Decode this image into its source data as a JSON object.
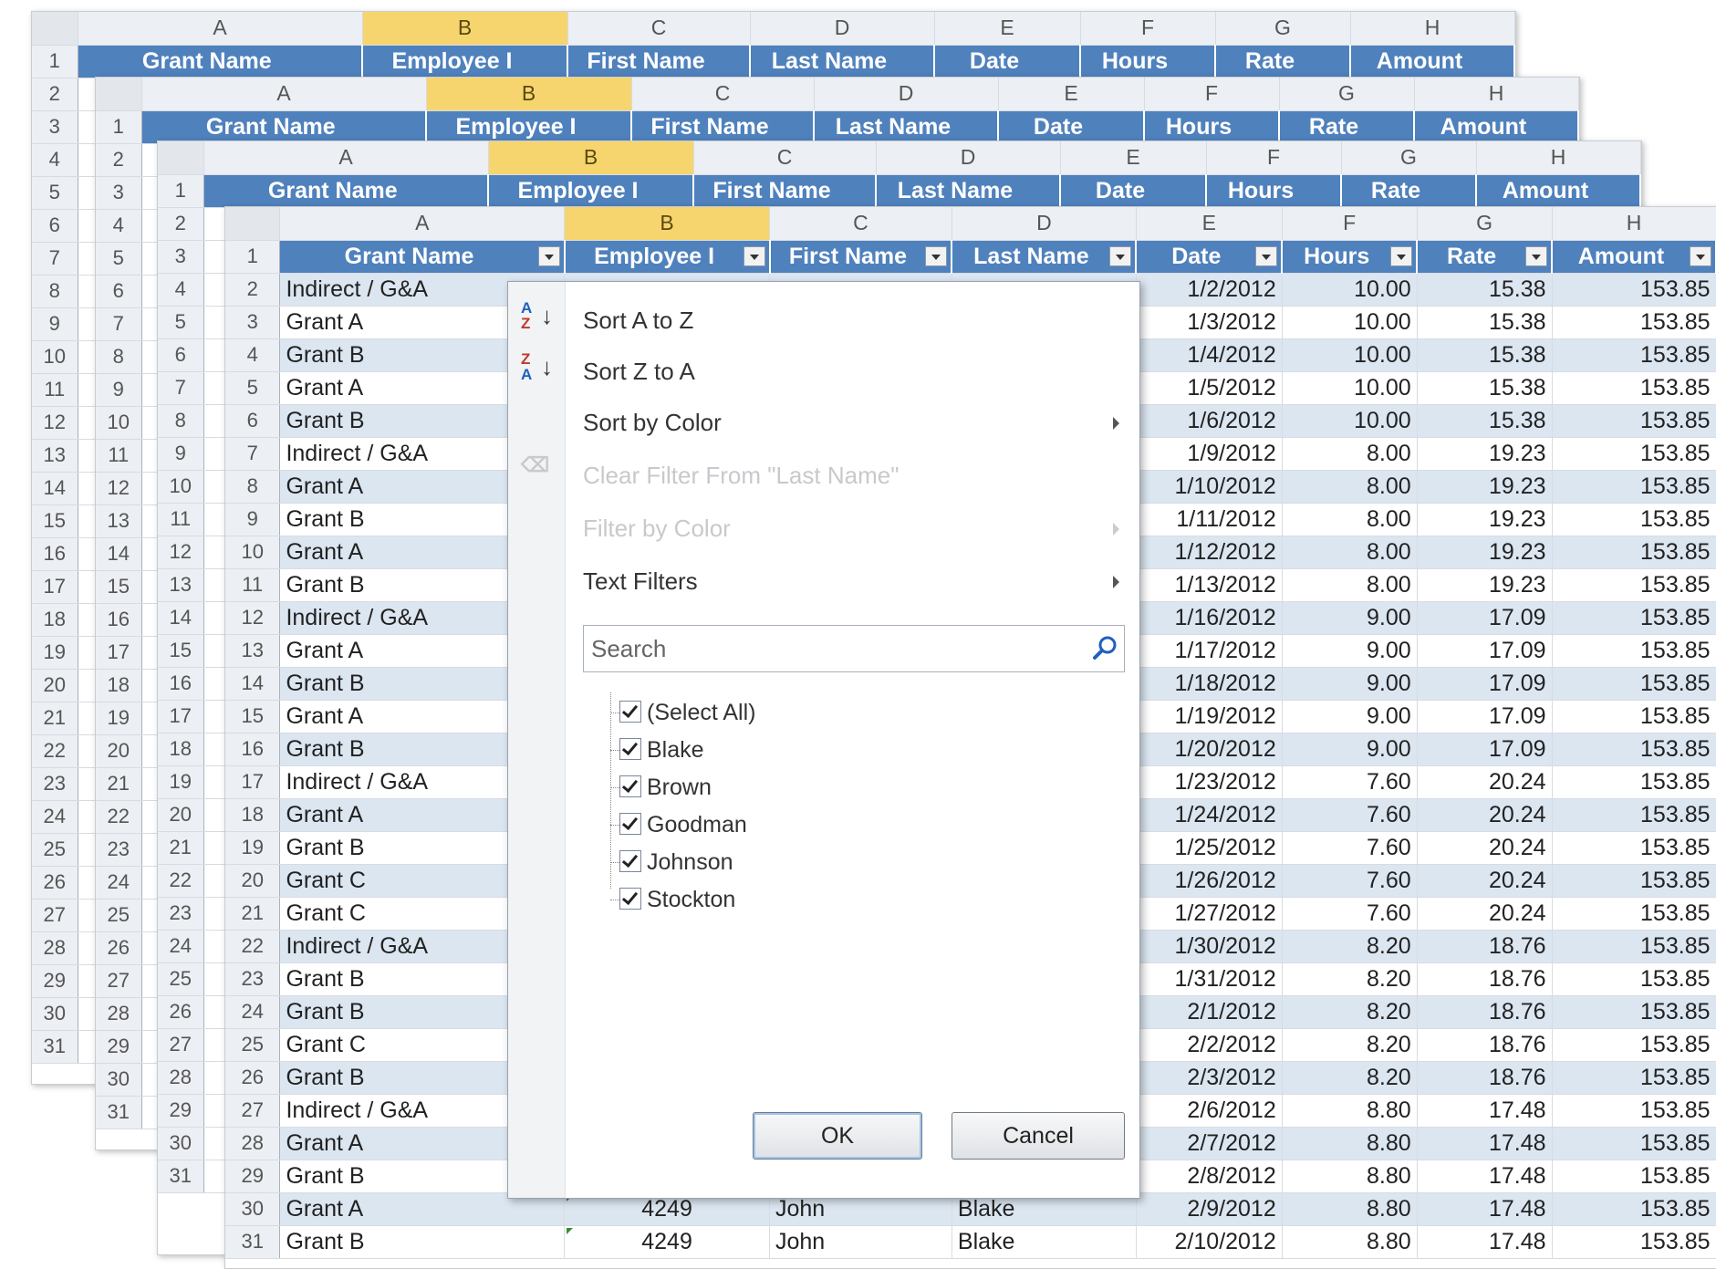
{
  "columns": [
    "A",
    "B",
    "C",
    "D",
    "E",
    "F",
    "G",
    "H"
  ],
  "selected_column": "B",
  "table_headers": [
    "Grant Name",
    "Employee I",
    "First Name",
    "Last Name",
    "Date",
    "Hours",
    "Rate",
    "Amount"
  ],
  "bg_rows_sheet1": [
    "1",
    "2",
    "3",
    "4",
    "5",
    "6",
    "7",
    "8",
    "9",
    "10",
    "11",
    "12",
    "13",
    "14",
    "15",
    "16",
    "17",
    "18",
    "19",
    "20",
    "21",
    "22",
    "23",
    "24",
    "25",
    "26",
    "27",
    "28",
    "29",
    "30",
    "31"
  ],
  "rows": [
    {
      "n": "2",
      "grant": "Indirect / G&A",
      "date": "1/2/2012",
      "hours": "10.00",
      "rate": "15.38",
      "amount": "153.85"
    },
    {
      "n": "3",
      "grant": "Grant A",
      "date": "1/3/2012",
      "hours": "10.00",
      "rate": "15.38",
      "amount": "153.85"
    },
    {
      "n": "4",
      "grant": "Grant B",
      "date": "1/4/2012",
      "hours": "10.00",
      "rate": "15.38",
      "amount": "153.85"
    },
    {
      "n": "5",
      "grant": "Grant A",
      "date": "1/5/2012",
      "hours": "10.00",
      "rate": "15.38",
      "amount": "153.85"
    },
    {
      "n": "6",
      "grant": "Grant B",
      "date": "1/6/2012",
      "hours": "10.00",
      "rate": "15.38",
      "amount": "153.85"
    },
    {
      "n": "7",
      "grant": "Indirect / G&A",
      "date": "1/9/2012",
      "hours": "8.00",
      "rate": "19.23",
      "amount": "153.85"
    },
    {
      "n": "8",
      "grant": "Grant A",
      "date": "1/10/2012",
      "hours": "8.00",
      "rate": "19.23",
      "amount": "153.85"
    },
    {
      "n": "9",
      "grant": "Grant B",
      "date": "1/11/2012",
      "hours": "8.00",
      "rate": "19.23",
      "amount": "153.85"
    },
    {
      "n": "10",
      "grant": "Grant A",
      "date": "1/12/2012",
      "hours": "8.00",
      "rate": "19.23",
      "amount": "153.85"
    },
    {
      "n": "11",
      "grant": "Grant B",
      "date": "1/13/2012",
      "hours": "8.00",
      "rate": "19.23",
      "amount": "153.85"
    },
    {
      "n": "12",
      "grant": "Indirect / G&A",
      "date": "1/16/2012",
      "hours": "9.00",
      "rate": "17.09",
      "amount": "153.85"
    },
    {
      "n": "13",
      "grant": "Grant A",
      "date": "1/17/2012",
      "hours": "9.00",
      "rate": "17.09",
      "amount": "153.85"
    },
    {
      "n": "14",
      "grant": "Grant B",
      "date": "1/18/2012",
      "hours": "9.00",
      "rate": "17.09",
      "amount": "153.85"
    },
    {
      "n": "15",
      "grant": "Grant A",
      "date": "1/19/2012",
      "hours": "9.00",
      "rate": "17.09",
      "amount": "153.85"
    },
    {
      "n": "16",
      "grant": "Grant B",
      "date": "1/20/2012",
      "hours": "9.00",
      "rate": "17.09",
      "amount": "153.85"
    },
    {
      "n": "17",
      "grant": "Indirect / G&A",
      "date": "1/23/2012",
      "hours": "7.60",
      "rate": "20.24",
      "amount": "153.85"
    },
    {
      "n": "18",
      "grant": "Grant A",
      "date": "1/24/2012",
      "hours": "7.60",
      "rate": "20.24",
      "amount": "153.85"
    },
    {
      "n": "19",
      "grant": "Grant B",
      "date": "1/25/2012",
      "hours": "7.60",
      "rate": "20.24",
      "amount": "153.85"
    },
    {
      "n": "20",
      "grant": "Grant C",
      "date": "1/26/2012",
      "hours": "7.60",
      "rate": "20.24",
      "amount": "153.85"
    },
    {
      "n": "21",
      "grant": "Grant C",
      "date": "1/27/2012",
      "hours": "7.60",
      "rate": "20.24",
      "amount": "153.85"
    },
    {
      "n": "22",
      "grant": "Indirect / G&A",
      "date": "1/30/2012",
      "hours": "8.20",
      "rate": "18.76",
      "amount": "153.85"
    },
    {
      "n": "23",
      "grant": "Grant B",
      "date": "1/31/2012",
      "hours": "8.20",
      "rate": "18.76",
      "amount": "153.85"
    },
    {
      "n": "24",
      "grant": "Grant B",
      "date": "2/1/2012",
      "hours": "8.20",
      "rate": "18.76",
      "amount": "153.85"
    },
    {
      "n": "25",
      "grant": "Grant C",
      "date": "2/2/2012",
      "hours": "8.20",
      "rate": "18.76",
      "amount": "153.85"
    },
    {
      "n": "26",
      "grant": "Grant B",
      "date": "2/3/2012",
      "hours": "8.20",
      "rate": "18.76",
      "amount": "153.85"
    },
    {
      "n": "27",
      "grant": "Indirect / G&A",
      "date": "2/6/2012",
      "hours": "8.80",
      "rate": "17.48",
      "amount": "153.85"
    },
    {
      "n": "28",
      "grant": "Grant A",
      "date": "2/7/2012",
      "hours": "8.80",
      "rate": "17.48",
      "amount": "153.85"
    },
    {
      "n": "29",
      "grant": "Grant B",
      "date": "2/8/2012",
      "hours": "8.80",
      "rate": "17.48",
      "amount": "153.85"
    },
    {
      "n": "30",
      "grant": "Grant A",
      "emp": "4249",
      "first": "John",
      "last": "Blake",
      "date": "2/9/2012",
      "hours": "8.80",
      "rate": "17.48",
      "amount": "153.85"
    },
    {
      "n": "31",
      "grant": "Grant B",
      "emp": "4249",
      "first": "John",
      "last": "Blake",
      "date": "2/10/2012",
      "hours": "8.80",
      "rate": "17.48",
      "amount": "153.85"
    }
  ],
  "filter_menu": {
    "sort_az": "Sort A to Z",
    "sort_za": "Sort Z to A",
    "sort_by_color": "Sort by Color",
    "clear_filter": "Clear Filter From \"Last Name\"",
    "filter_by_color": "Filter by Color",
    "text_filters": "Text Filters",
    "search_placeholder": "Search",
    "items": [
      "(Select All)",
      "Blake",
      "Brown",
      "Goodman",
      "Johnson",
      "Stockton"
    ],
    "ok": "OK",
    "cancel": "Cancel"
  },
  "colors": {
    "table_header": "#4f81bd",
    "band": "#dce6f1",
    "selected_col": "#f7d56e"
  }
}
